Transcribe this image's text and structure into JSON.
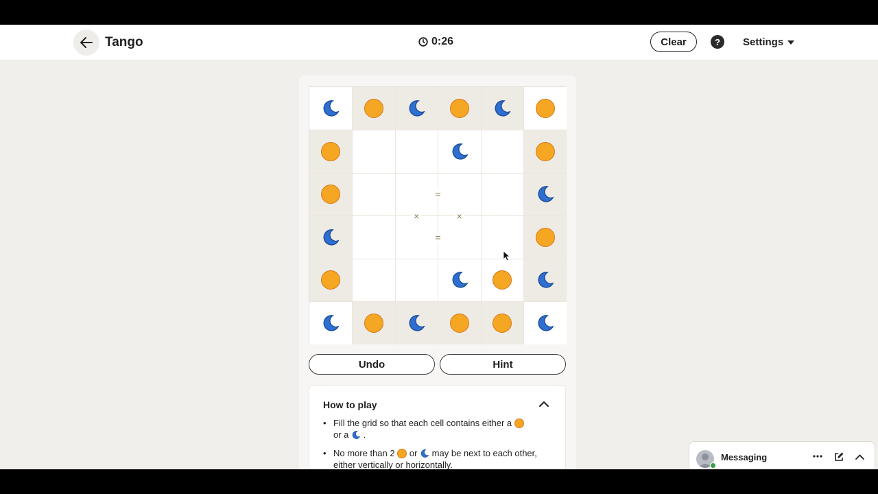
{
  "header": {
    "title": "Tango",
    "timer": "0:26",
    "clear_label": "Clear",
    "help_label": "?",
    "settings_label": "Settings"
  },
  "board": {
    "size": 6,
    "cells": [
      [
        "moon",
        "sun",
        "moon",
        "sun",
        "moon",
        "sun"
      ],
      [
        "sun",
        "",
        "",
        "moon",
        "",
        "sun"
      ],
      [
        "sun",
        "",
        "",
        "",
        "",
        "moon"
      ],
      [
        "moon",
        "",
        "",
        "",
        "",
        "sun"
      ],
      [
        "sun",
        "",
        "",
        "moon",
        "sun",
        "moon"
      ],
      [
        "moon",
        "sun",
        "moon",
        "sun",
        "sun",
        "moon"
      ]
    ],
    "locked": [
      [
        false,
        true,
        true,
        true,
        true,
        false
      ],
      [
        true,
        false,
        false,
        false,
        false,
        true
      ],
      [
        true,
        false,
        false,
        false,
        false,
        true
      ],
      [
        true,
        false,
        false,
        false,
        false,
        true
      ],
      [
        true,
        false,
        false,
        false,
        false,
        true
      ],
      [
        false,
        true,
        true,
        true,
        true,
        false
      ]
    ],
    "constraints": [
      {
        "symbol": "=",
        "between": [
          [
            2,
            2
          ],
          [
            2,
            3
          ]
        ]
      },
      {
        "symbol": "×",
        "between": [
          [
            2,
            2
          ],
          [
            3,
            2
          ]
        ]
      },
      {
        "symbol": "×",
        "between": [
          [
            2,
            3
          ],
          [
            3,
            3
          ]
        ]
      },
      {
        "symbol": "=",
        "between": [
          [
            3,
            2
          ],
          [
            3,
            3
          ]
        ]
      }
    ],
    "colors": {
      "sun": "#f5a623",
      "moon": "#2f6fd1",
      "locked_bg": "#eeebe5"
    }
  },
  "controls": {
    "undo_label": "Undo",
    "hint_label": "Hint"
  },
  "how_to_play": {
    "title": "How to play",
    "rule1_a": "Fill the grid so that each cell contains either a",
    "rule1_b": "or a",
    "rule1_c": ".",
    "rule2_a": "No more than 2",
    "rule2_b": "or",
    "rule2_c": "may be next to each other, either vertically or horizontally."
  },
  "messaging": {
    "label": "Messaging"
  }
}
